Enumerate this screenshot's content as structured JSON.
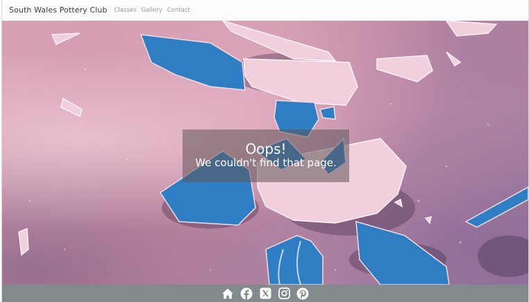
{
  "navbar": {
    "brand": "South Wales Pottery Club",
    "links": [
      {
        "label": "Classes"
      },
      {
        "label": "Gallery"
      },
      {
        "label": "Contact"
      }
    ]
  },
  "error": {
    "title": "Oops!",
    "message": "We couldn't find that page."
  },
  "footer": {
    "icons": [
      "home-icon",
      "facebook-icon",
      "x-twitter-icon",
      "instagram-icon",
      "pinterest-icon"
    ]
  },
  "colors": {
    "footer_bg": "#838a8e",
    "shard_blue": "#2f7ec4",
    "shard_pink": "#f1cfdc"
  }
}
